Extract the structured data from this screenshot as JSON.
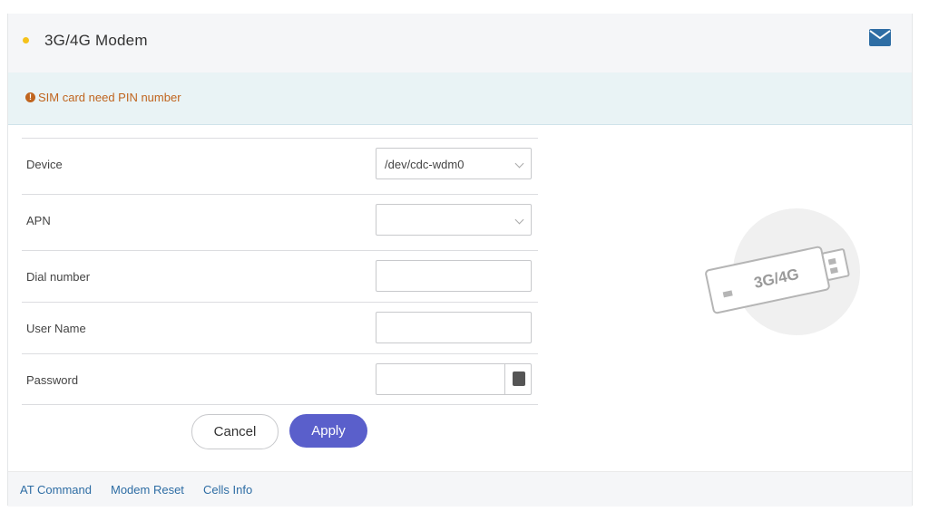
{
  "header": {
    "title": "3G/4G Modem",
    "status_color": "#f5c21b",
    "mail_icon": "envelope-icon"
  },
  "alert": {
    "icon": "exclamation-circle-icon",
    "text": "SIM card need PIN number",
    "color": "#c0651f"
  },
  "form": {
    "device_label": "Device",
    "device_value": "/dev/cdc-wdm0",
    "apn_label": "APN",
    "apn_value": "",
    "dial_label": "Dial number",
    "dial_value": "",
    "user_label": "User Name",
    "user_value": "",
    "password_label": "Password",
    "password_value": ""
  },
  "buttons": {
    "cancel": "Cancel",
    "apply": "Apply",
    "apply_color": "#5a5fcb"
  },
  "footer": {
    "links": [
      "AT Command",
      "Modem Reset",
      "Cells Info"
    ]
  },
  "illustration": {
    "label": "3G/4G"
  }
}
